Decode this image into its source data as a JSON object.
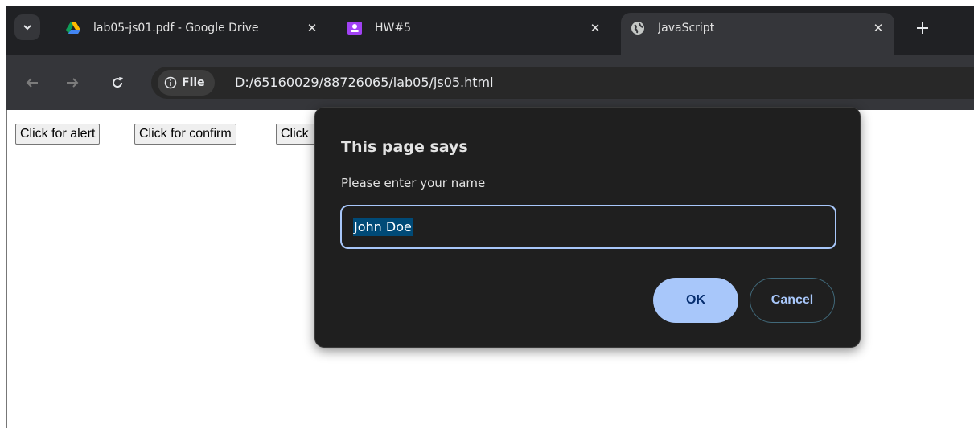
{
  "tabs": [
    {
      "title": "lab05-js01.pdf - Google Drive",
      "icon": "google-drive-icon"
    },
    {
      "title": "HW#5",
      "icon": "classroom-icon"
    },
    {
      "title": "JavaScript",
      "icon": "globe-icon",
      "active": true
    }
  ],
  "toolbar": {
    "chip_label": "File",
    "url": "D:/65160029/88726065/lab05/js05.html"
  },
  "page": {
    "buttons": [
      "Click for alert",
      "Click for confirm",
      "Click"
    ]
  },
  "dialog": {
    "title": "This page says",
    "message": "Please enter your name",
    "input_value": "John Doe",
    "ok_label": "OK",
    "cancel_label": "Cancel"
  },
  "colors": {
    "accent": "#a8c7fa",
    "dialog_bg": "#1f1f1f",
    "selection": "#004a77"
  }
}
